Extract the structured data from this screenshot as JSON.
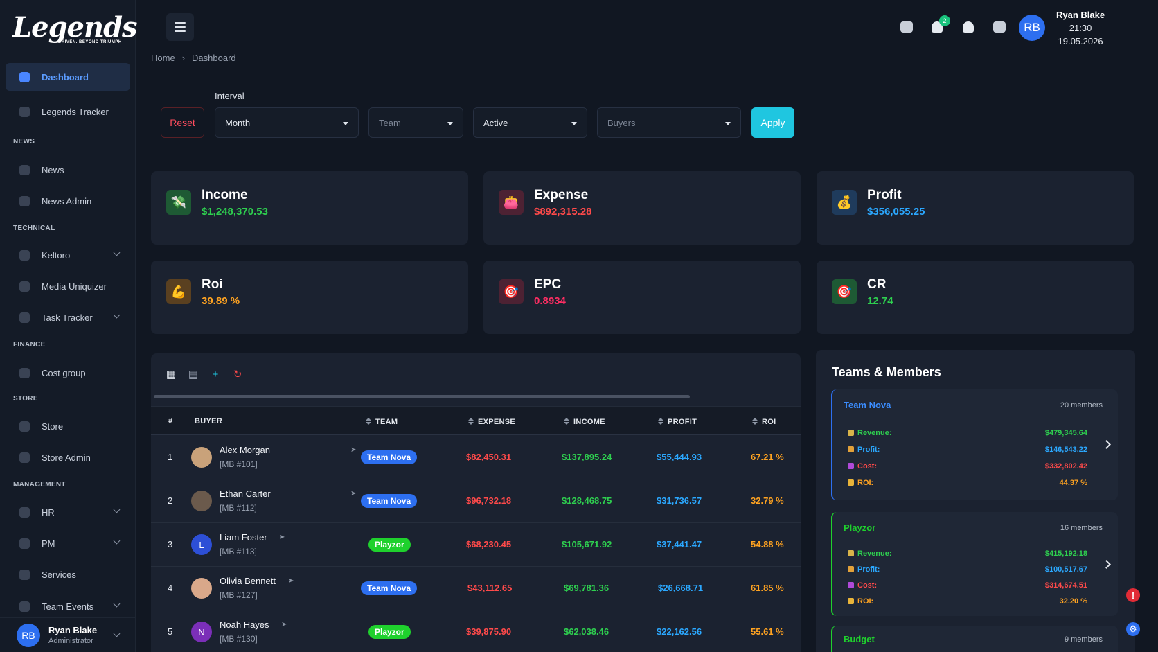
{
  "brand": {
    "logo_text": "Legends",
    "tagline": "DRIVEN. BEYOND TRIUMPH"
  },
  "sidebar": {
    "items": [
      {
        "label": "Dashboard",
        "icon": "dashboard-icon"
      },
      {
        "label": "Legends Tracker",
        "icon": "tracker-icon"
      },
      {
        "label": "News",
        "icon": "news-icon"
      },
      {
        "label": "News Admin",
        "icon": "news-admin-icon"
      },
      {
        "label": "Keltoro",
        "icon": "keltoro-icon"
      },
      {
        "label": "Media Uniquizer",
        "icon": "media-icon"
      },
      {
        "label": "Task Tracker",
        "icon": "task-icon"
      },
      {
        "label": "Cost group",
        "icon": "cost-group-icon"
      },
      {
        "label": "Store",
        "icon": "store-icon"
      },
      {
        "label": "Store Admin",
        "icon": "store-admin-icon"
      },
      {
        "label": "HR",
        "icon": "hr-icon"
      },
      {
        "label": "PM",
        "icon": "pm-icon"
      },
      {
        "label": "Services",
        "icon": "services-icon"
      },
      {
        "label": "Team Events",
        "icon": "team-events-icon"
      }
    ],
    "sections": [
      "NEWS",
      "TECHNICAL",
      "FINANCE",
      "STORE",
      "MANAGEMENT"
    ],
    "user": {
      "initials": "RB",
      "name": "Ryan Blake",
      "role": "Administrator"
    }
  },
  "header": {
    "notification_count": "2",
    "user_initials": "RB",
    "user_name": "Ryan Blake",
    "time": "21:30",
    "date": "19.05.2026"
  },
  "breadcrumb": {
    "home": "Home",
    "current": "Dashboard"
  },
  "filters": {
    "reset_label": "Reset",
    "interval_label": "Interval",
    "interval_value": "Month",
    "team_placeholder": "Team",
    "status_value": "Active",
    "buyers_placeholder": "Buyers",
    "apply_label": "Apply"
  },
  "kpis": [
    {
      "title": "Income",
      "value": "$1,248,370.53",
      "color": "#2ecf4f",
      "icon": "money-icon"
    },
    {
      "title": "Expense",
      "value": "$892,315.28",
      "color": "#ff4a4a",
      "icon": "expense-icon"
    },
    {
      "title": "Profit",
      "value": "$356,055.25",
      "color": "#2ba8ff",
      "icon": "money-bag-icon"
    },
    {
      "title": "Roi",
      "value": "39.89 %",
      "color": "#ffa321",
      "icon": "muscle-icon"
    },
    {
      "title": "EPC",
      "value": "0.8934",
      "color": "#ff2e63",
      "icon": "epc-icon"
    },
    {
      "title": "CR",
      "value": "12.74",
      "color": "#2ecf4f",
      "icon": "target-icon"
    }
  ],
  "table": {
    "headers": {
      "rank": "#",
      "buyer": "BUYER",
      "team": "TEAM",
      "expense": "EXPENSE",
      "income": "INCOME",
      "profit": "PROFIT",
      "roi": "ROI"
    },
    "rows": [
      {
        "rank": "1",
        "name": "Alex Morgan",
        "id": "[MB #101]",
        "initial": "",
        "team": "Team Nova",
        "expense": "$82,450.31",
        "income": "$137,895.24",
        "profit": "$55,444.93",
        "roi": "67.21 %"
      },
      {
        "rank": "2",
        "name": "Ethan Carter",
        "id": "[MB #112]",
        "initial": "",
        "team": "Team Nova",
        "expense": "$96,732.18",
        "income": "$128,468.75",
        "profit": "$31,736.57",
        "roi": "32.79 %"
      },
      {
        "rank": "3",
        "name": "Liam Foster",
        "id": "[MB #113]",
        "initial": "L",
        "team": "Playzor",
        "expense": "$68,230.45",
        "income": "$105,671.92",
        "profit": "$37,441.47",
        "roi": "54.88 %"
      },
      {
        "rank": "4",
        "name": "Olivia Bennett",
        "id": "[MB #127]",
        "initial": "",
        "team": "Team Nova",
        "expense": "$43,112.65",
        "income": "$69,781.36",
        "profit": "$26,668.71",
        "roi": "61.85 %"
      },
      {
        "rank": "5",
        "name": "Noah Hayes",
        "id": "[MB #130]",
        "initial": "N",
        "team": "Playzor",
        "expense": "$39,875.90",
        "income": "$62,038.46",
        "profit": "$22,162.56",
        "roi": "55.61 %"
      }
    ]
  },
  "teams_panel": {
    "title": "Teams & Members",
    "labels": {
      "revenue": "Revenue:",
      "profit": "Profit:",
      "cost": "Cost:",
      "roi": "ROI:"
    },
    "teams": [
      {
        "name": "Team Nova",
        "members": "20 members",
        "revenue": "$479,345.64",
        "profit": "$146,543.22",
        "cost": "$332,802.42",
        "roi": "44.37 %"
      },
      {
        "name": "Playzor",
        "members": "16 members",
        "revenue": "$415,192.18",
        "profit": "$100,517.67",
        "cost": "$314,674.51",
        "roi": "32.20 %"
      },
      {
        "name": "Budget",
        "members": "9 members"
      }
    ]
  },
  "colors": {
    "accent_blue": "#2d6ff0",
    "green": "#2ecf4f",
    "red": "#ff4a4a",
    "cyan": "#1fc6e0",
    "orange": "#ffa321",
    "team_nova_pill": "#2d6ff0",
    "playzor_pill": "#1fd12d"
  }
}
